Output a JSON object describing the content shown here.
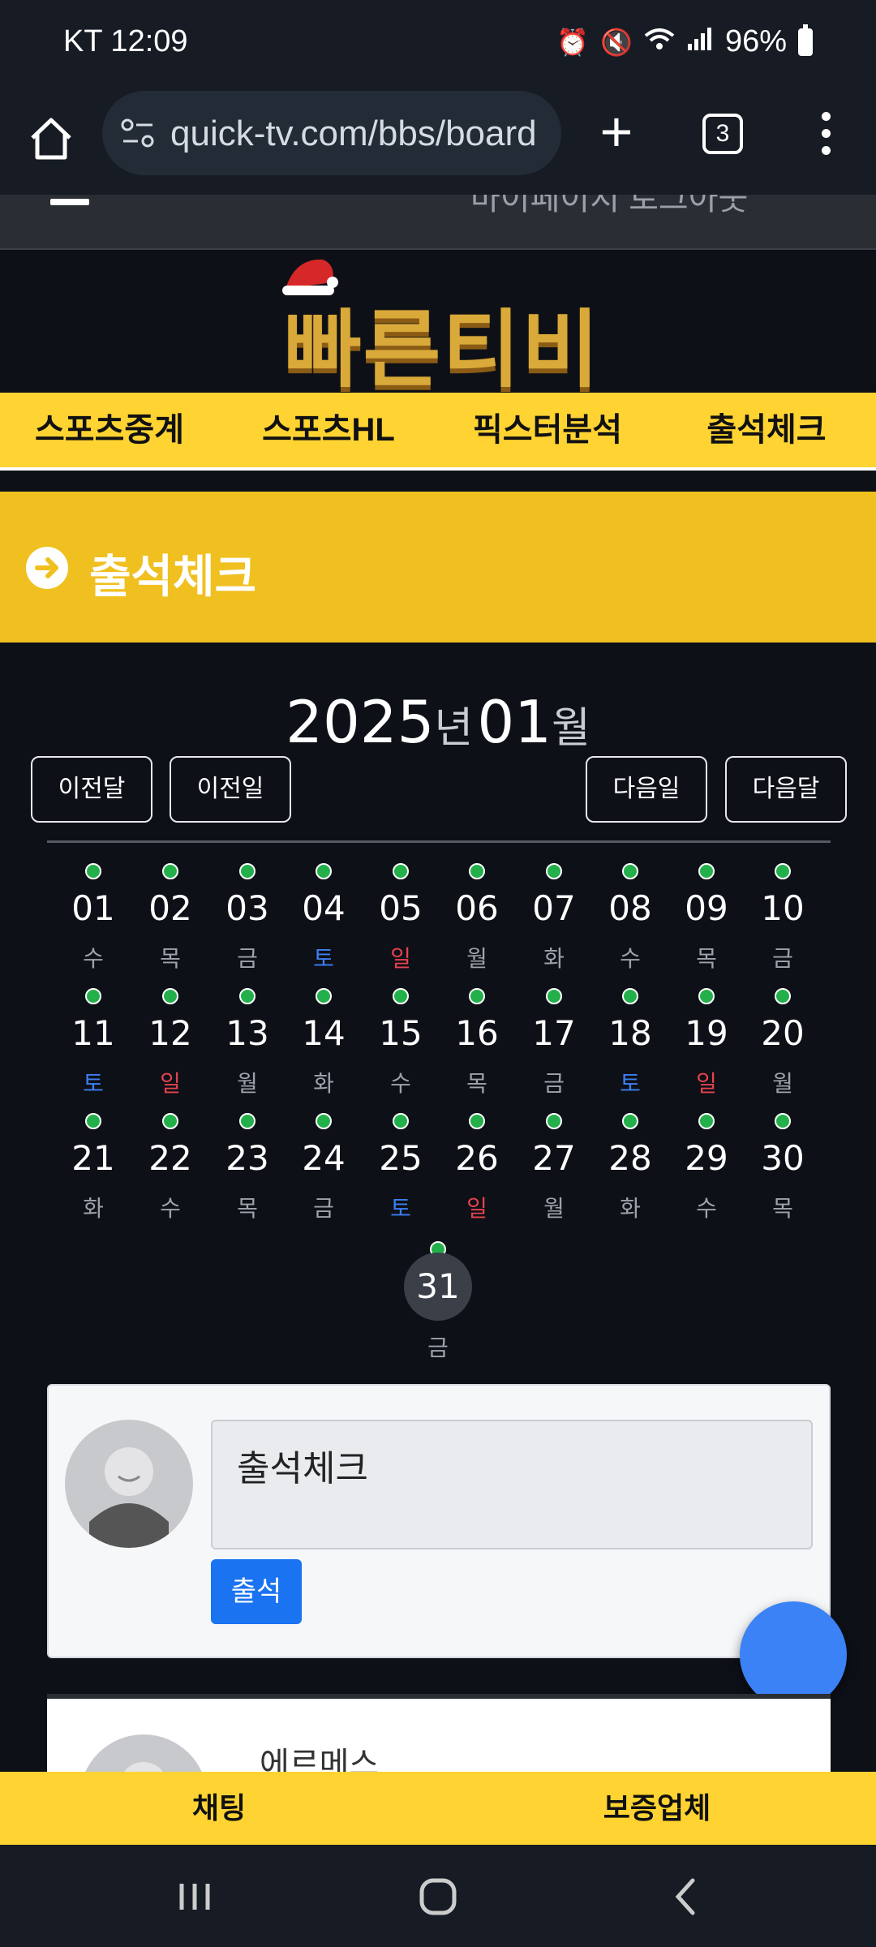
{
  "status_bar": {
    "carrier_time": "KT 12:09",
    "battery": "96%"
  },
  "browser": {
    "url": "quick-tv.com/bbs/board",
    "tab_count": "3"
  },
  "top_strip_text": "마이페이지  로그아웃",
  "logo_text": "빠른티비",
  "nav": [
    "스포츠중계",
    "스포츠HL",
    "픽스터분석",
    "출석체크"
  ],
  "page_title": "출석체크",
  "calendar": {
    "year": "2025",
    "year_suffix": "년",
    "month": "01",
    "month_suffix": "월",
    "buttons": {
      "prev_month": "이전달",
      "prev_day": "이전일",
      "next_day": "다음일",
      "next_month": "다음달"
    },
    "days": [
      {
        "num": "01",
        "wd": "수"
      },
      {
        "num": "02",
        "wd": "목"
      },
      {
        "num": "03",
        "wd": "금"
      },
      {
        "num": "04",
        "wd": "토"
      },
      {
        "num": "05",
        "wd": "일"
      },
      {
        "num": "06",
        "wd": "월"
      },
      {
        "num": "07",
        "wd": "화"
      },
      {
        "num": "08",
        "wd": "수"
      },
      {
        "num": "09",
        "wd": "목"
      },
      {
        "num": "10",
        "wd": "금"
      },
      {
        "num": "11",
        "wd": "토"
      },
      {
        "num": "12",
        "wd": "일"
      },
      {
        "num": "13",
        "wd": "월"
      },
      {
        "num": "14",
        "wd": "화"
      },
      {
        "num": "15",
        "wd": "수"
      },
      {
        "num": "16",
        "wd": "목"
      },
      {
        "num": "17",
        "wd": "금"
      },
      {
        "num": "18",
        "wd": "토"
      },
      {
        "num": "19",
        "wd": "일"
      },
      {
        "num": "20",
        "wd": "월"
      },
      {
        "num": "21",
        "wd": "화"
      },
      {
        "num": "22",
        "wd": "수"
      },
      {
        "num": "23",
        "wd": "목"
      },
      {
        "num": "24",
        "wd": "금"
      },
      {
        "num": "25",
        "wd": "토"
      },
      {
        "num": "26",
        "wd": "일"
      },
      {
        "num": "27",
        "wd": "월"
      },
      {
        "num": "28",
        "wd": "화"
      },
      {
        "num": "29",
        "wd": "수"
      },
      {
        "num": "30",
        "wd": "목"
      },
      {
        "num": "31",
        "wd": "금"
      }
    ],
    "today": "31",
    "colors": {
      "dot": "#23b04a",
      "saturday": "#3d7ff2",
      "sunday": "#e5424d"
    }
  },
  "comment_form": {
    "textarea_value": "출석체크",
    "submit_label": "출석"
  },
  "comment_preview": {
    "name": "에르메스"
  },
  "bottom_bar": [
    "채팅",
    "보증업체"
  ]
}
